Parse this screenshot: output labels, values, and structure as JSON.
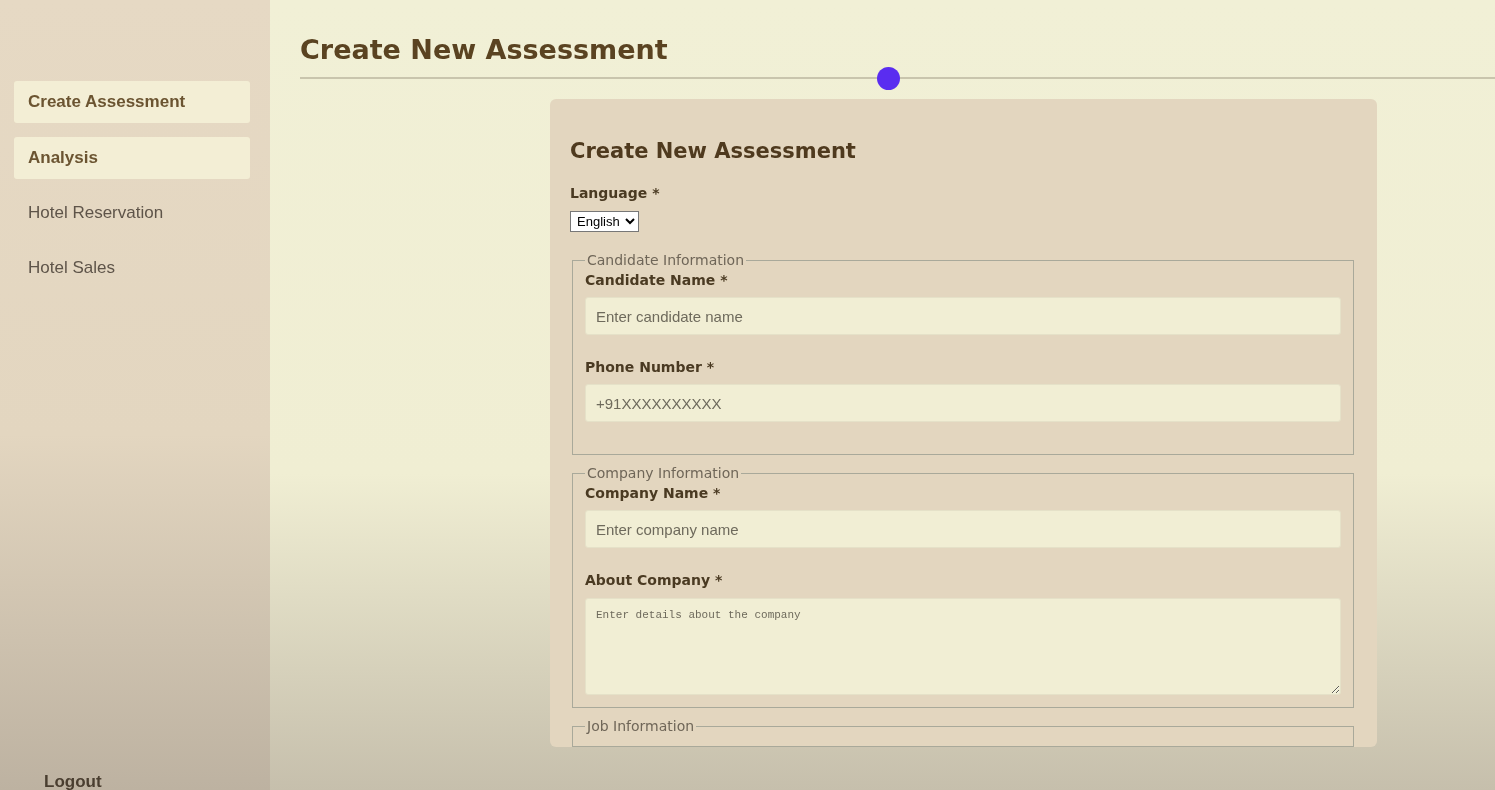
{
  "sidebar": {
    "items": [
      {
        "label": "Create Assessment",
        "kind": "button"
      },
      {
        "label": "Analysis",
        "kind": "button"
      },
      {
        "label": "Hotel Reservation",
        "kind": "link"
      },
      {
        "label": "Hotel Sales",
        "kind": "link"
      }
    ],
    "logout": "Logout"
  },
  "page_title": "Create New Assessment",
  "form": {
    "title": "Create New Assessment",
    "language": {
      "label": "Language *",
      "value": "English"
    },
    "sections": [
      {
        "legend": "Candidate Information",
        "fields": [
          {
            "label": "Candidate Name *",
            "kind": "input",
            "placeholder": "Enter candidate name"
          },
          {
            "label": "Phone Number *",
            "kind": "input",
            "placeholder": "+91XXXXXXXXXX"
          }
        ]
      },
      {
        "legend": "Company Information",
        "fields": [
          {
            "label": "Company Name *",
            "kind": "input",
            "placeholder": "Enter company name"
          },
          {
            "label": "About Company *",
            "kind": "textarea",
            "placeholder": "Enter details about the company"
          }
        ]
      },
      {
        "legend": "Job Information"
      }
    ]
  }
}
